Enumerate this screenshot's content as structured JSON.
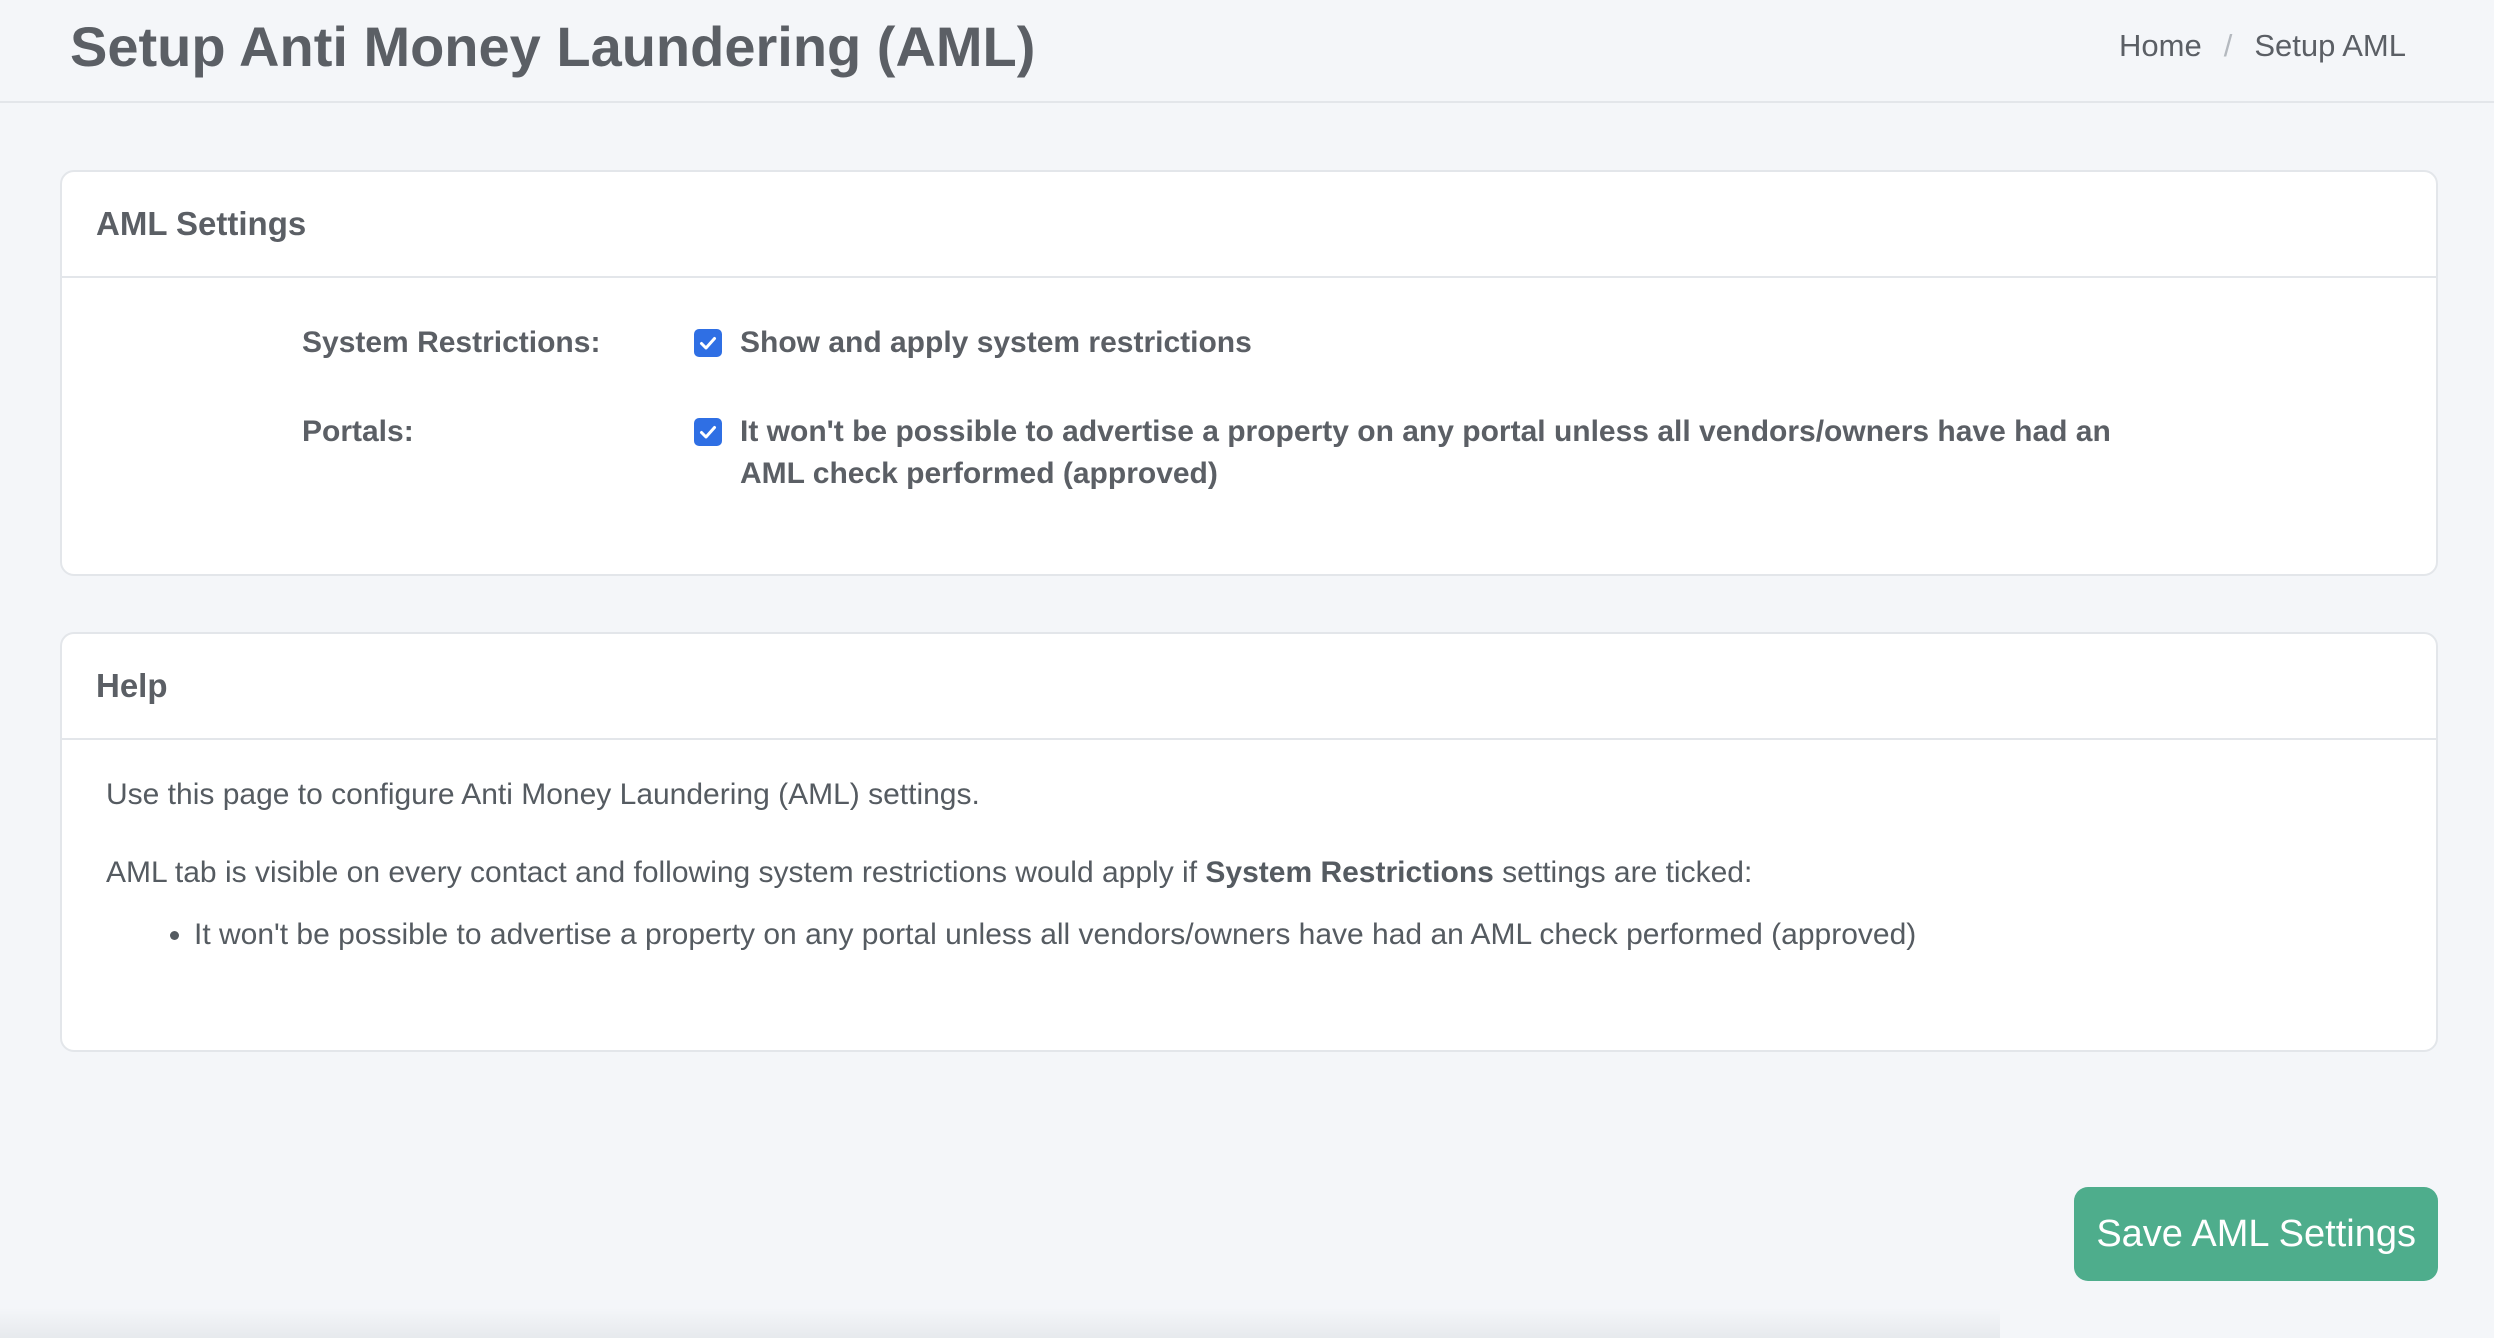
{
  "header": {
    "title": "Setup Anti Money Laundering (AML)",
    "breadcrumb": {
      "home": "Home",
      "separator": "/",
      "current": "Setup AML"
    }
  },
  "aml_settings": {
    "title": "AML Settings",
    "rows": [
      {
        "label": "System Restrictions:",
        "checked": true,
        "text": "Show and apply system restrictions"
      },
      {
        "label": "Portals:",
        "checked": true,
        "text": "It won't be possible to advertise a property on any portal unless all vendors/owners have had an AML check performed (approved)"
      }
    ]
  },
  "help": {
    "title": "Help",
    "intro": "Use this page to configure Anti Money Laundering (AML) settings.",
    "restrictions_prefix": "AML tab is visible on every contact and following system restrictions would apply if ",
    "restrictions_bold": "System Restrictions",
    "restrictions_suffix": " settings are ticked:",
    "bullets": [
      "It won't be possible to advertise a property on any portal unless all vendors/owners have had an AML check performed (approved)"
    ]
  },
  "footer": {
    "save_label": "Save AML Settings"
  },
  "colors": {
    "accent_button": "#4ead8c",
    "checkbox": "#2f6fe4",
    "background": "#f4f6f9"
  }
}
